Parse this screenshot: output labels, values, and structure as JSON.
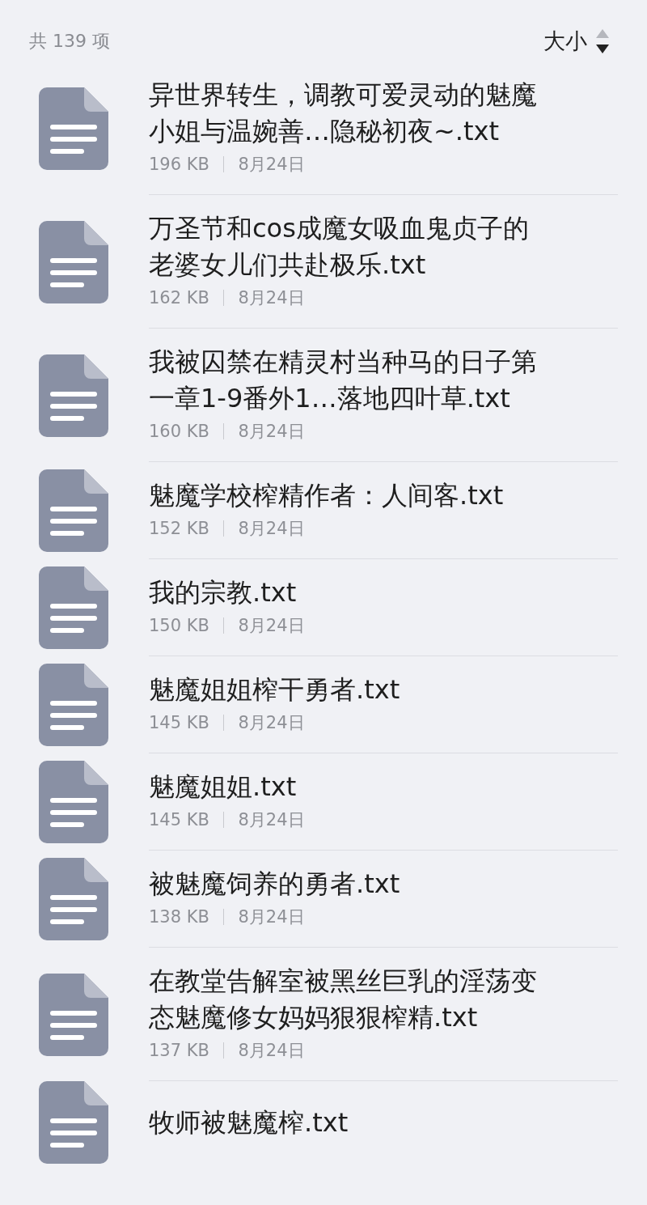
{
  "header": {
    "count": "共 139 项",
    "sort_label": "大小",
    "sort_descending": true
  },
  "files": [
    {
      "name": "异世界转生，调教可爱灵动的魅魔小姐与温婉善…隐秘初夜~.txt",
      "size": "196 KB",
      "date": "8月24日"
    },
    {
      "name": "万圣节和cos成魔女吸血鬼贞子的老婆女儿们共赴极乐.txt",
      "size": "162 KB",
      "date": "8月24日"
    },
    {
      "name": "我被囚禁在精灵村当种马的日子第一章1-9番外1…落地四叶草.txt",
      "size": "160 KB",
      "date": "8月24日"
    },
    {
      "name": "魅魔学校榨精作者：人间客.txt",
      "size": "152 KB",
      "date": "8月24日"
    },
    {
      "name": "我的宗教.txt",
      "size": "150 KB",
      "date": "8月24日"
    },
    {
      "name": "魅魔姐姐榨干勇者.txt",
      "size": "145 KB",
      "date": "8月24日"
    },
    {
      "name": "魅魔姐姐.txt",
      "size": "145 KB",
      "date": "8月24日"
    },
    {
      "name": "被魅魔饲养的勇者.txt",
      "size": "138 KB",
      "date": "8月24日"
    },
    {
      "name": "在教堂告解室被黑丝巨乳的淫荡变态魅魔修女妈妈狠狠榨精.txt",
      "size": "137 KB",
      "date": "8月24日"
    },
    {
      "name": "牧师被魅魔榨.txt"
    }
  ]
}
